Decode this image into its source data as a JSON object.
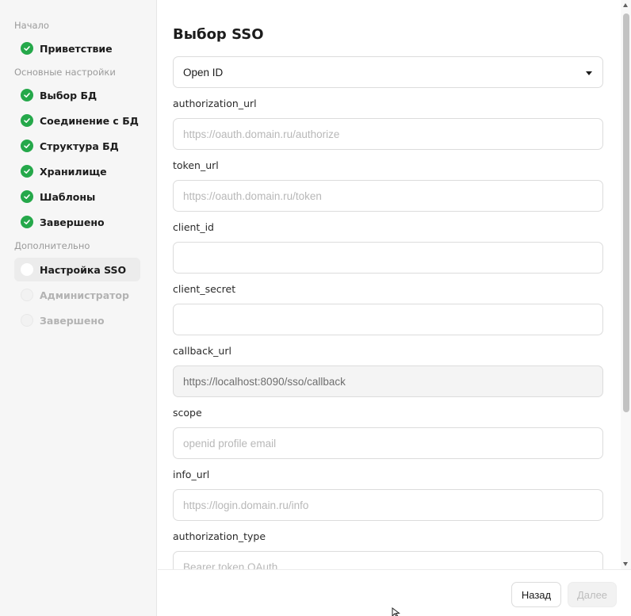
{
  "sidebar": {
    "sections": [
      {
        "label": "Начало"
      },
      {
        "label": "Основные настройки"
      },
      {
        "label": "Дополнительно"
      }
    ],
    "steps": [
      {
        "label": "Приветствие",
        "status": "done"
      },
      {
        "label": "Выбор БД",
        "status": "done"
      },
      {
        "label": "Соединение с БД",
        "status": "done"
      },
      {
        "label": "Структура БД",
        "status": "done"
      },
      {
        "label": "Хранилище",
        "status": "done"
      },
      {
        "label": "Шаблоны",
        "status": "done"
      },
      {
        "label": "Завершено",
        "status": "done"
      },
      {
        "label": "Настройка SSO",
        "status": "current"
      },
      {
        "label": "Администратор",
        "status": "pending"
      },
      {
        "label": "Завершено",
        "status": "pending"
      }
    ]
  },
  "main": {
    "title": "Выбор SSO",
    "sso_type": {
      "selected": "Open ID"
    },
    "fields": [
      {
        "label": "authorization_url",
        "value": "",
        "placeholder": "https://oauth.domain.ru/authorize"
      },
      {
        "label": "token_url",
        "value": "",
        "placeholder": "https://oauth.domain.ru/token"
      },
      {
        "label": "client_id",
        "value": "",
        "placeholder": ""
      },
      {
        "label": "client_secret",
        "value": "",
        "placeholder": ""
      },
      {
        "label": "callback_url",
        "value": "https://localhost:8090/sso/callback",
        "placeholder": "",
        "readonly": true
      },
      {
        "label": "scope",
        "value": "",
        "placeholder": "openid profile email"
      },
      {
        "label": "info_url",
        "value": "",
        "placeholder": "https://login.domain.ru/info"
      },
      {
        "label": "authorization_type",
        "value": "",
        "placeholder": "Bearer token OAuth"
      }
    ]
  },
  "footer": {
    "back_label": "Назад",
    "next_label": "Далее"
  },
  "colors": {
    "done": "#25a84a",
    "sidebar_bg": "#f6f6f6",
    "active_step_bg": "#ececec",
    "border": "#dcdcdc"
  },
  "icons": {
    "done": "check-circle-icon",
    "current": "circle-icon",
    "pending": "circle-icon"
  }
}
